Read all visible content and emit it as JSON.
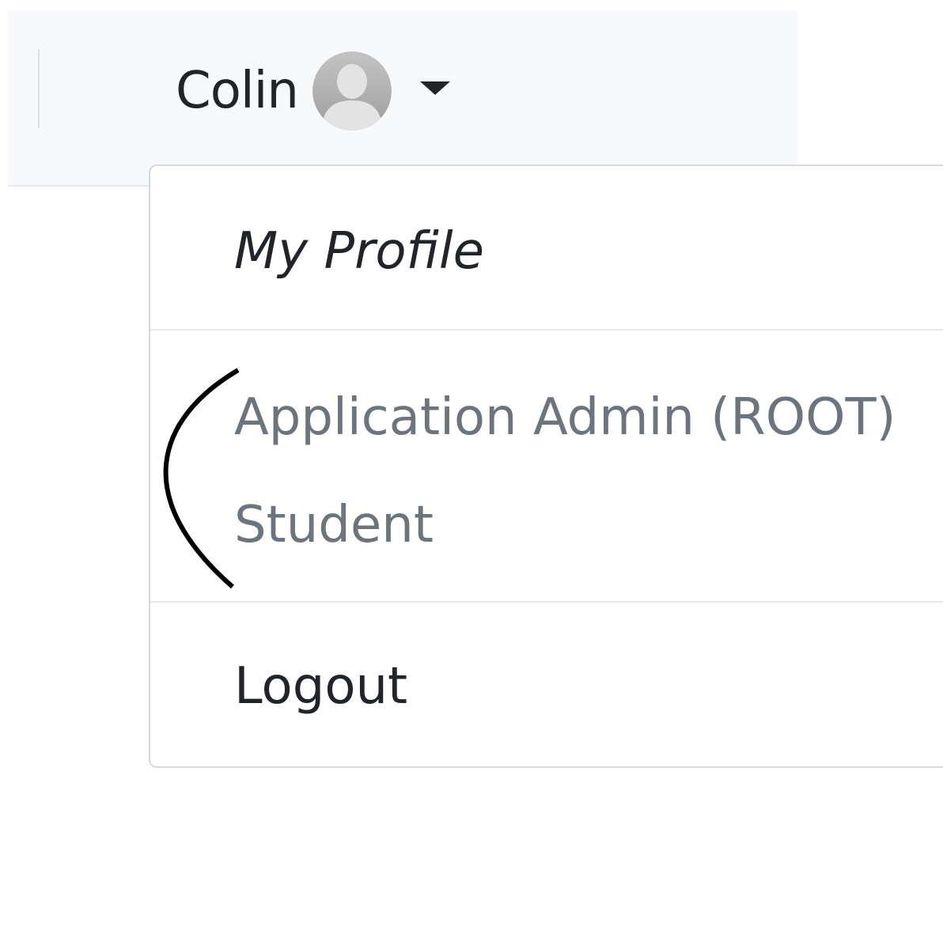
{
  "navbar": {
    "user_name": "Colin",
    "avatar_icon": "user-avatar-icon",
    "caret_icon": "caret-down-icon"
  },
  "dropdown": {
    "profile_label": "My Profile",
    "roles": [
      "Application Admin (ROOT)",
      "Student"
    ],
    "logout_label": "Logout"
  },
  "annotation": {
    "bracket_icon": "hand-drawn-bracket"
  },
  "colors": {
    "navbar_bg": "#f8f9fa",
    "text_primary": "#212529",
    "text_muted": "#6c757d",
    "border": "#d6d9dd"
  }
}
